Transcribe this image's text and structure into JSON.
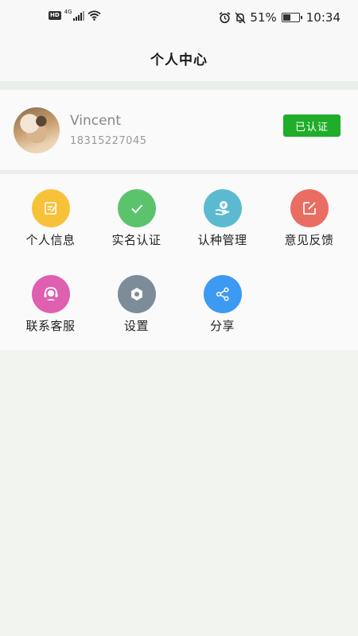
{
  "status_bar": {
    "network_badge": "HD",
    "network_type": "4G",
    "battery_percent": "51%",
    "battery_level": 0.51,
    "time": "10:34"
  },
  "header": {
    "title": "个人中心"
  },
  "profile": {
    "name": "Vincent",
    "phone": "18315227045",
    "badge": "已认证",
    "badge_color": "#20ad2a"
  },
  "menu": {
    "items": [
      {
        "label": "个人信息",
        "icon": "edit-doc-icon",
        "color": "#f7c23a"
      },
      {
        "label": "实名认证",
        "icon": "check-icon",
        "color": "#5cc36d"
      },
      {
        "label": "认种管理",
        "icon": "hand-coin-icon",
        "color": "#5bbad0"
      },
      {
        "label": "意见反馈",
        "icon": "compose-icon",
        "color": "#ea6d63"
      },
      {
        "label": "联系客服",
        "icon": "headset-icon",
        "color": "#df5fb0"
      },
      {
        "label": "设置",
        "icon": "gear-icon",
        "color": "#7c8c99"
      },
      {
        "label": "分享",
        "icon": "share-icon",
        "color": "#3d9af2"
      }
    ]
  }
}
